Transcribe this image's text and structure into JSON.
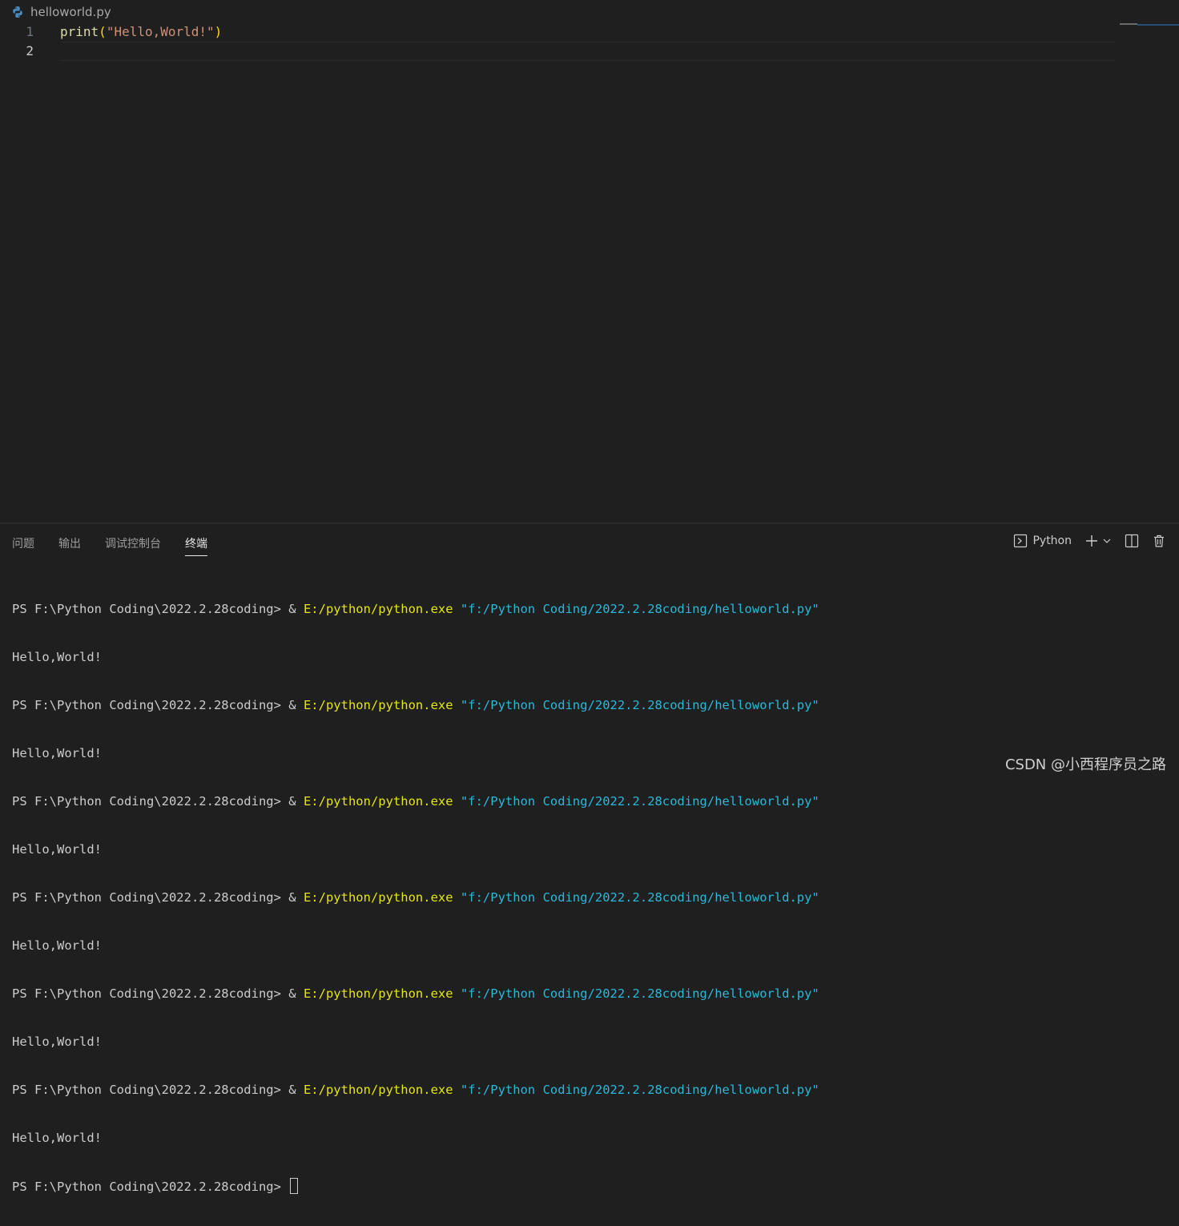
{
  "editor": {
    "file_name": "helloworld.py",
    "lines": [
      {
        "number": "1",
        "func": "print",
        "open": "(",
        "string": "\"Hello,World!\"",
        "close": ")"
      },
      {
        "number": "2"
      }
    ]
  },
  "panel": {
    "tabs": [
      "问题",
      "输出",
      "调试控制台",
      "终端"
    ],
    "active_tab": "终端",
    "shell_label": "Python"
  },
  "terminal": {
    "prompt": "PS F:\\Python Coding\\2022.2.28coding> ",
    "amp": "& ",
    "exe": "E:/python/python.exe",
    "script": " \"f:/Python Coding/2022.2.28coding/helloworld.py\"",
    "output": "Hello,World!",
    "runs": 6
  },
  "watermark": "CSDN @小西程序员之路",
  "colors": {
    "background": "#1f1f1f",
    "string": "#ce9178",
    "function": "#dcdcaa",
    "terminal_command": "#e5e510",
    "terminal_path": "#29b8db"
  }
}
